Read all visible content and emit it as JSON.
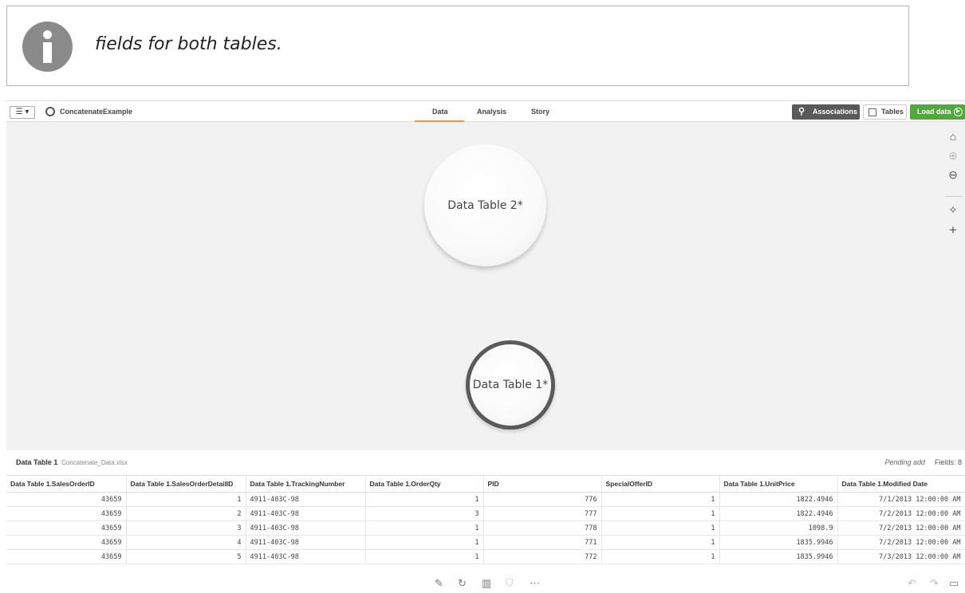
{
  "note": {
    "icon": "info-icon",
    "text": "fields for both tables."
  },
  "toolbar": {
    "menu_label": "☰ ▾",
    "app_name": "ConcatenateExample",
    "tabs": [
      {
        "label": "Data",
        "active": true
      },
      {
        "label": "Analysis",
        "active": false
      },
      {
        "label": "Story",
        "active": false
      }
    ],
    "associations_label": "Associations",
    "tables_label": "Tables",
    "load_label": "Load data"
  },
  "canvas": {
    "bubbles": [
      {
        "label": "Data Table 2*"
      },
      {
        "label": "Data Table 1*"
      }
    ],
    "side_icons": [
      "home-icon",
      "zoom-in-icon",
      "zoom-out-icon",
      "magic-wand-icon",
      "add-icon"
    ]
  },
  "panel": {
    "title": "Data Table 1",
    "file": "Concatenate_Data.xlsx",
    "status": "Pending add",
    "fields": "Fields: 8"
  },
  "table": {
    "columns": [
      "Data Table 1.SalesOrderID",
      "Data Table 1.SalesOrderDetailID",
      "Data Table 1.TrackingNumber",
      "Data Table 1.OrderQty",
      "PID",
      "SpecialOfferID",
      "Data Table 1.UnitPrice",
      "Data Table 1.Modified Date"
    ],
    "rows": [
      [
        "43659",
        "1",
        "4911-403C-98",
        "1",
        "776",
        "1",
        "1822.4946",
        "7/1/2013 12:00:00 AM"
      ],
      [
        "43659",
        "2",
        "4911-403C-98",
        "3",
        "777",
        "1",
        "1822.4946",
        "7/2/2013 12:00:00 AM"
      ],
      [
        "43659",
        "3",
        "4911-403C-98",
        "1",
        "778",
        "1",
        "1098.9",
        "7/2/2013 12:00:00 AM"
      ],
      [
        "43659",
        "4",
        "4911-403C-98",
        "1",
        "771",
        "1",
        "1835.9946",
        "7/2/2013 12:00:00 AM"
      ],
      [
        "43659",
        "5",
        "4911-403C-98",
        "1",
        "772",
        "1",
        "1835.9946",
        "7/3/2013 12:00:00 AM"
      ]
    ]
  },
  "bottom_bar": {
    "icons": [
      "edit-icon",
      "refresh-icon",
      "delete-icon",
      "filter-icon",
      "more-icon",
      "undo-icon",
      "redo-icon",
      "panel-toggle-icon"
    ]
  },
  "colors": {
    "accent": "#ef9b3a",
    "load_green": "#52a83a",
    "assoc_dark": "#595959"
  }
}
